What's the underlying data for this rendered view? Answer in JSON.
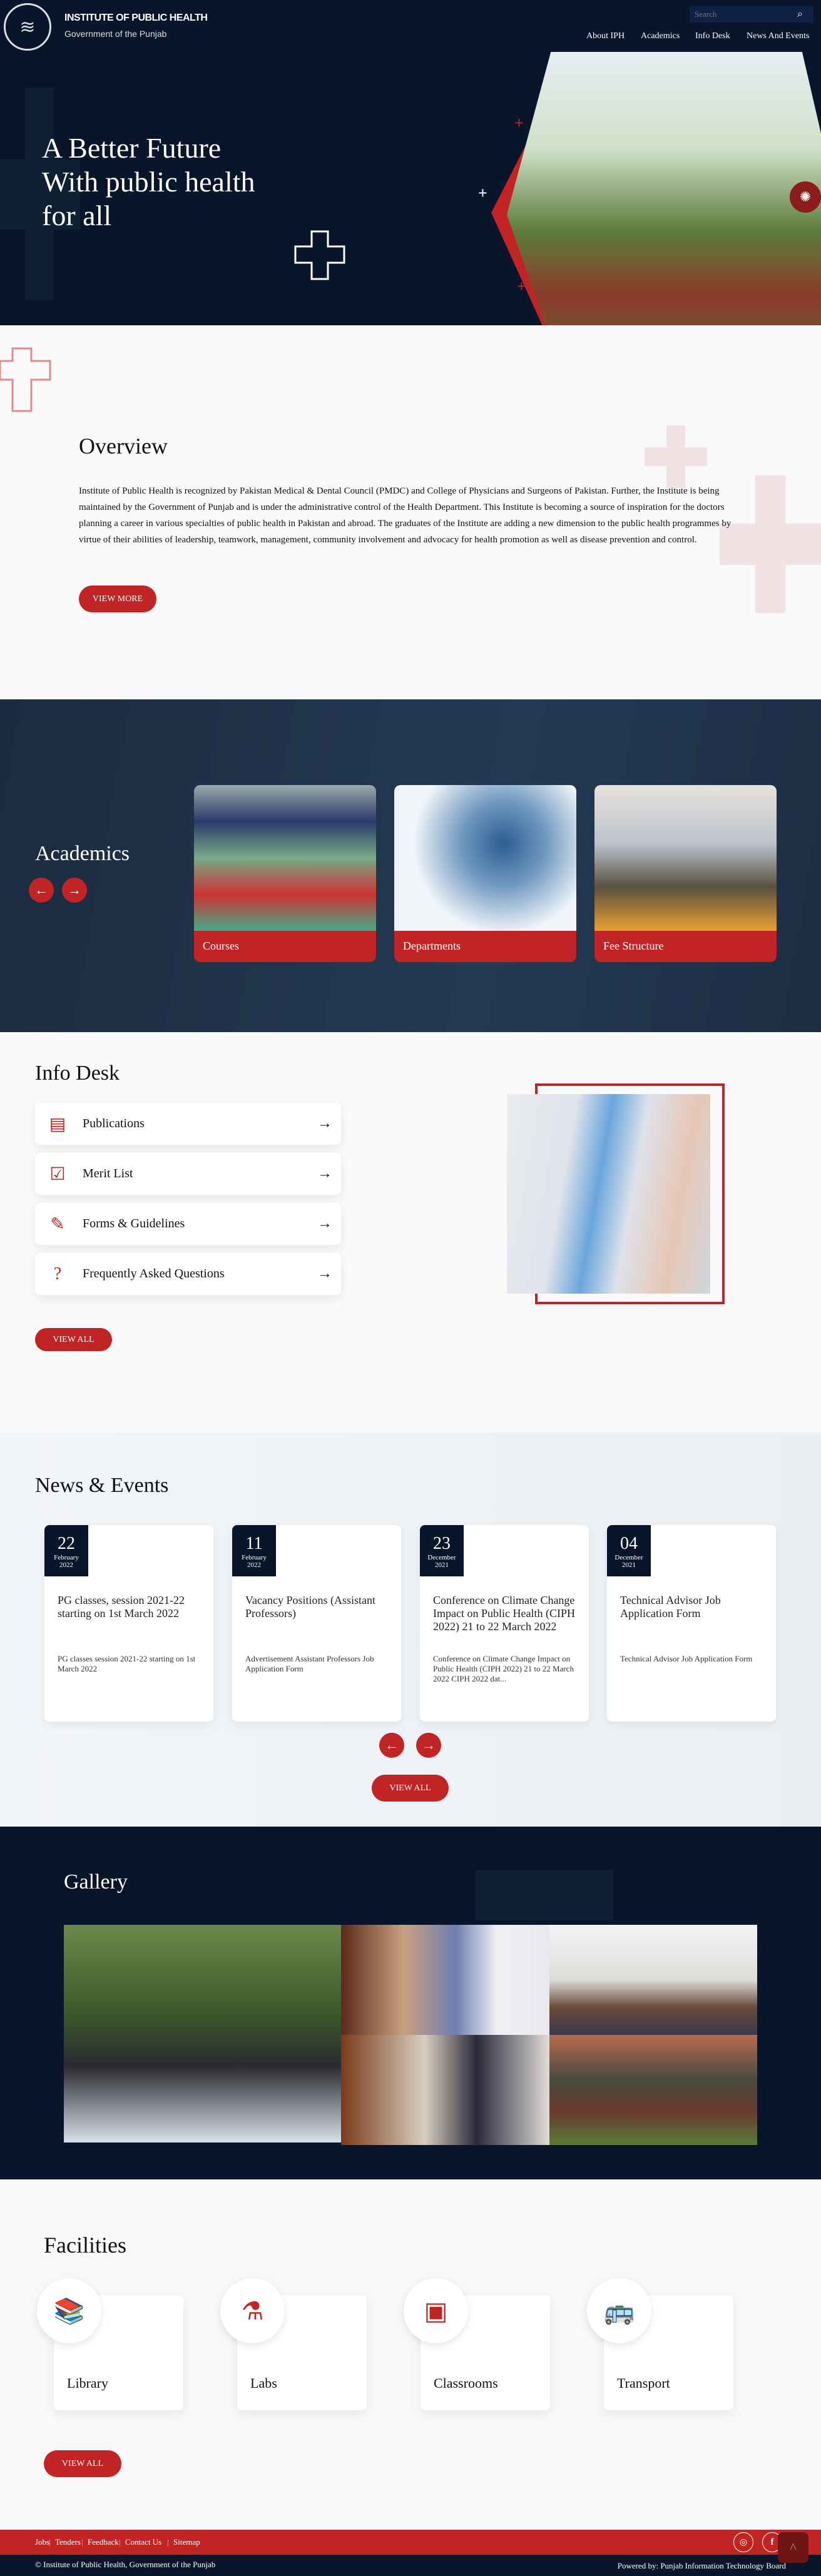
{
  "colors": {
    "navy": "#08152a",
    "red": "#c02424"
  },
  "header": {
    "title": "INSTITUTE OF PUBLIC HEALTH",
    "subtitle": "Government of the Punjab",
    "search_placeholder": "Search",
    "nav": [
      "About IPH",
      "Academics",
      "Info Desk",
      "News And Events"
    ]
  },
  "hero": {
    "lines": [
      "A Better Future",
      "With public health",
      "for all"
    ]
  },
  "overview": {
    "title": "Overview",
    "text": "Institute of Public Health is recognized by Pakistan Medical & Dental Council (PMDC) and College of Physicians and Surgeons of Pakistan. Further, the Institute is being maintained by the Government of Punjab and is under the administrative control of the Health Department. This Institute is becoming a source of inspiration for the doctors planning a career in various specialties of public health in Pakistan and abroad. The graduates of the Institute are adding a new dimension to the public health programmes by virtue of their abilities of leadership, teamwork, management, community involvement and advocacy for health promotion as well as disease prevention and control.",
    "button": "VIEW MORE"
  },
  "academics": {
    "title": "Academics",
    "cards": [
      "Courses",
      "Departments",
      "Fee Structure"
    ]
  },
  "info_desk": {
    "title": "Info Desk",
    "items": [
      {
        "label": "Publications",
        "icon": "newspaper-icon"
      },
      {
        "label": "Merit List",
        "icon": "checklist-icon"
      },
      {
        "label": "Forms & Guidelines",
        "icon": "form-pencil-icon"
      },
      {
        "label": "Frequently Asked Questions",
        "icon": "question-chat-icon"
      }
    ],
    "button": "VIEW ALL"
  },
  "news": {
    "title": "News & Events",
    "items": [
      {
        "day": "22",
        "month": "February",
        "year": "2022",
        "title": "PG classes, session 2021-22 starting on 1st March 2022",
        "desc": "PG classes session 2021-22 starting on 1st March 2022"
      },
      {
        "day": "11",
        "month": "February",
        "year": "2022",
        "title": "Vacancy Positions (Assistant Professors)",
        "desc": "Advertisement Assistant Professors Job Application Form"
      },
      {
        "day": "23",
        "month": "December",
        "year": "2021",
        "title": "Conference on Climate Change Impact on Public Health (CIPH 2022) 21 to 22 March 2022",
        "desc": "Conference on Climate Change Impact on Public Health (CIPH 2022) 21 to 22 March 2022 CIPH 2022 dat..."
      },
      {
        "day": "04",
        "month": "December",
        "year": "2021",
        "title": "Technical Advisor Job Application Form",
        "desc": "Technical Advisor Job Application Form"
      }
    ],
    "button": "VIEW ALL"
  },
  "gallery": {
    "title": "Gallery"
  },
  "facilities": {
    "title": "Facilities",
    "items": [
      {
        "label": "Library",
        "icon": "books-icon"
      },
      {
        "label": "Labs",
        "icon": "flask-icon"
      },
      {
        "label": "Classrooms",
        "icon": "classroom-icon"
      },
      {
        "label": "Transport",
        "icon": "bus-icon"
      }
    ],
    "button": "VIEW ALL"
  },
  "footer": {
    "links": [
      "Jobs",
      "Tenders",
      "Feedback",
      "Contact Us",
      "Sitemap"
    ],
    "copyright": "© Institute of Public Health, Government of the Punjab",
    "powered": "Powered by: Punjab Information Technology Board"
  }
}
